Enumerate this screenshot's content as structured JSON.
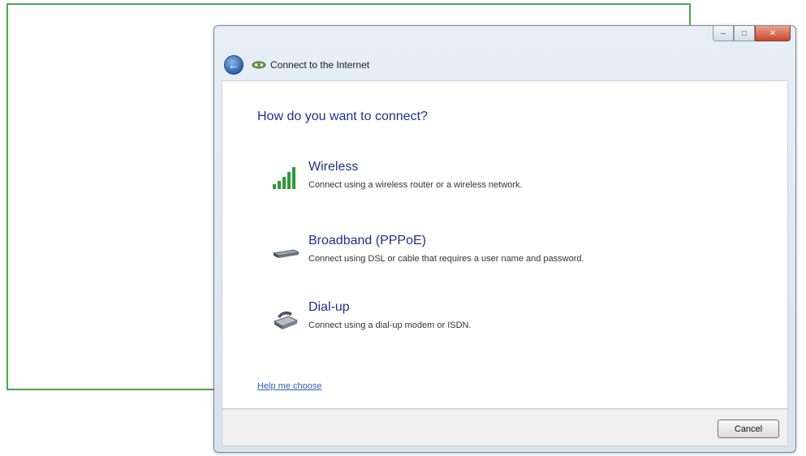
{
  "window": {
    "title": "Connect to the Internet",
    "caption": {
      "minimize_glyph": "–",
      "maximize_glyph": "□",
      "close_glyph": "✕"
    }
  },
  "nav": {
    "back_glyph": "←"
  },
  "main": {
    "heading": "How do you want to connect?",
    "options": [
      {
        "title": "Wireless",
        "description": "Connect using a wireless router or a wireless network.",
        "icon": "wireless-signal-icon"
      },
      {
        "title": "Broadband (PPPoE)",
        "description": "Connect using DSL or cable that requires a user name and password.",
        "icon": "broadband-modem-icon"
      },
      {
        "title": "Dial-up",
        "description": "Connect using a dial-up modem or ISDN.",
        "icon": "dialup-modem-icon"
      }
    ],
    "help_link": "Help me choose"
  },
  "footer": {
    "cancel_label": "Cancel"
  },
  "colors": {
    "heading": "#1e3287",
    "link": "#2a5fb8",
    "callout_border": "#4aa64a",
    "signal_green": "#2e9a35"
  }
}
